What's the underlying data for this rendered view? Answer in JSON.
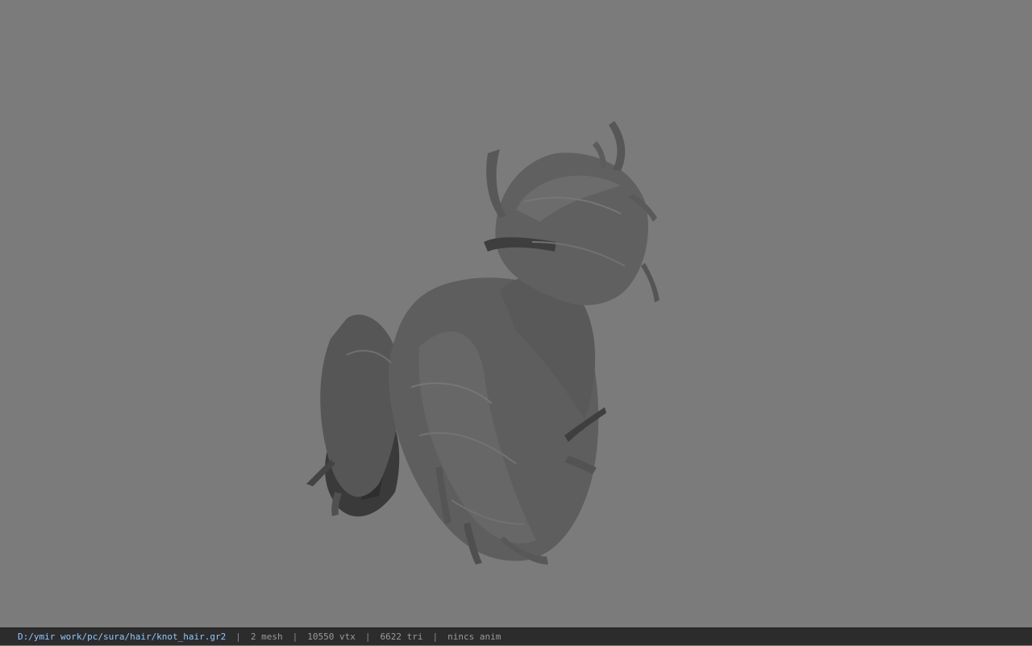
{
  "viewport": {
    "model_icon": "hair-mesh-icon",
    "background_color": "#7b7b7b",
    "mesh_color": "#5a5a5a"
  },
  "status_bar": {
    "file_path": "D:/ymir work/pc/sura/hair/knot_hair.gr2",
    "mesh_count": "2 mesh",
    "vertex_count": "10550 vtx",
    "triangle_count": "6622 tri",
    "anim_status": "nincs anim",
    "separator": "|",
    "path_color": "#8fc8ff"
  }
}
